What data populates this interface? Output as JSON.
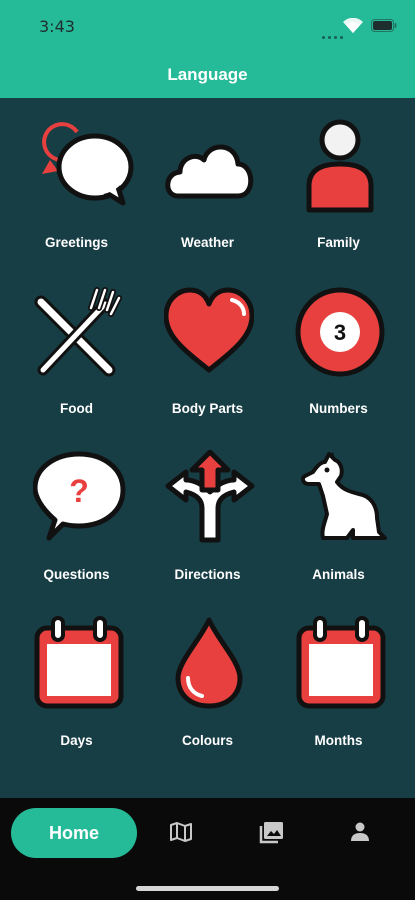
{
  "status_bar": {
    "time": "3:43"
  },
  "header": {
    "title": "Language"
  },
  "categories": [
    {
      "label": "Greetings",
      "icon": "speech-bubble-icon"
    },
    {
      "label": "Weather",
      "icon": "cloud-icon"
    },
    {
      "label": "Family",
      "icon": "person-icon"
    },
    {
      "label": "Food",
      "icon": "fork-knife-icon"
    },
    {
      "label": "Body Parts",
      "icon": "heart-icon"
    },
    {
      "label": "Numbers",
      "icon": "number-ball-icon"
    },
    {
      "label": "Questions",
      "icon": "question-bubble-icon"
    },
    {
      "label": "Directions",
      "icon": "directions-arrows-icon"
    },
    {
      "label": "Animals",
      "icon": "dog-icon"
    },
    {
      "label": "Days",
      "icon": "calendar-icon"
    },
    {
      "label": "Colours",
      "icon": "drop-icon"
    },
    {
      "label": "Months",
      "icon": "calendar-icon"
    }
  ],
  "icon_text": {
    "number_ball": "3",
    "question_mark": "?"
  },
  "tab_bar": {
    "home_label": "Home",
    "tabs": [
      "map-icon",
      "gallery-icon",
      "profile-icon"
    ]
  },
  "colors": {
    "accent": "#26bb98",
    "background": "#173d45",
    "icon_red": "#e8403e",
    "tab_bar": "#0a0a0a"
  }
}
